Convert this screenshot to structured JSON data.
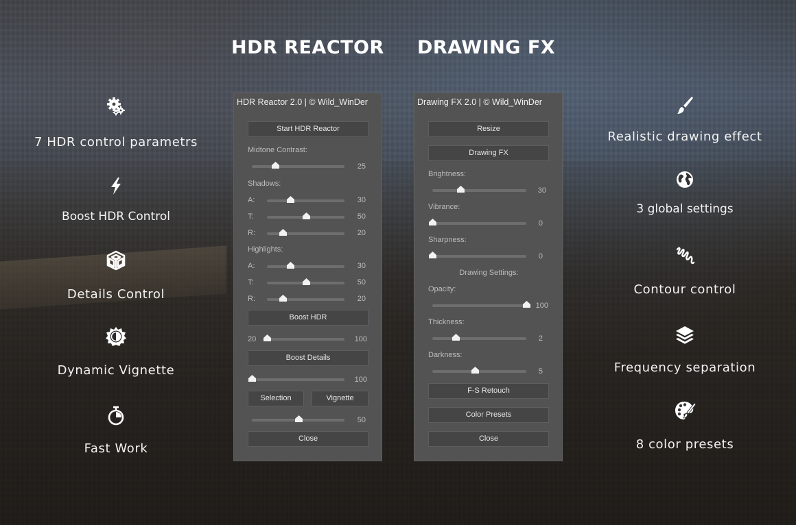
{
  "titles": {
    "hdr": "HDR REACTOR",
    "fx": "DRAWING FX"
  },
  "features_left": [
    {
      "icon": "gears-icon",
      "label": "7 HDR control parametrs"
    },
    {
      "icon": "lightning-icon",
      "label": "Boost HDR Control"
    },
    {
      "icon": "cube-icon",
      "label": "Details Control"
    },
    {
      "icon": "contrast-sun-icon",
      "label": "Dynamic Vignette"
    },
    {
      "icon": "stopwatch-icon",
      "label": "Fast Work"
    }
  ],
  "features_right": [
    {
      "icon": "paintbrush-icon",
      "label": "Realistic drawing effect"
    },
    {
      "icon": "globe-icon",
      "label": "3 global settings"
    },
    {
      "icon": "scribble-icon",
      "label": "Contour control"
    },
    {
      "icon": "layers-icon",
      "label": "Frequency separation"
    },
    {
      "icon": "palette-icon",
      "label": "8 color presets"
    }
  ],
  "hdr_panel": {
    "title": "HDR Reactor 2.0 | © Wild_WinDer",
    "start_button": "Start HDR Reactor",
    "midtone_label": "Midtone Contrast:",
    "midtone": {
      "value": "25",
      "fraction": 0.25
    },
    "shadows_label": "Shadows:",
    "shadows": [
      {
        "label": "A:",
        "value": "30",
        "fraction": 0.3
      },
      {
        "label": "T:",
        "value": "50",
        "fraction": 0.5
      },
      {
        "label": "R:",
        "value": "20",
        "fraction": 0.2
      }
    ],
    "highlights_label": "Highlights:",
    "highlights": [
      {
        "label": "A:",
        "value": "30",
        "fraction": 0.3
      },
      {
        "label": "T:",
        "value": "50",
        "fraction": 0.5
      },
      {
        "label": "R:",
        "value": "20",
        "fraction": 0.2
      }
    ],
    "boost_hdr_button": "Boost HDR",
    "boost_range": {
      "min": "20",
      "max": "100",
      "fraction": 0.0
    },
    "boost_details_button": "Boost Details",
    "details_slider": {
      "value": "100",
      "fraction": 0.0
    },
    "selection_button": "Selection",
    "vignette_button": "Vignette",
    "vignette_slider": {
      "value": "50",
      "fraction": 0.5
    },
    "close_button": "Close"
  },
  "fx_panel": {
    "title": "Drawing FX 2.0 | © Wild_WinDer",
    "resize_button": "Resize",
    "drawing_button": "Drawing FX",
    "brightness_label": "Brightness:",
    "brightness": {
      "value": "30",
      "fraction": 0.3
    },
    "vibrance_label": "Vibrance:",
    "vibrance": {
      "value": "0",
      "fraction": 0.0
    },
    "sharpness_label": "Sharpness:",
    "sharpness": {
      "value": "0",
      "fraction": 0.0
    },
    "drawing_settings_label": "Drawing Settings:",
    "opacity_label": "Opacity:",
    "opacity": {
      "value": "100",
      "fraction": 1.0
    },
    "thickness_label": "Thickness:",
    "thickness": {
      "value": "2",
      "fraction": 0.25
    },
    "darkness_label": "Darkness:",
    "darkness": {
      "value": "5",
      "fraction": 0.45
    },
    "fs_retouch_button": "F-S Retouch",
    "color_presets_button": "Color Presets",
    "close_button": "Close"
  }
}
